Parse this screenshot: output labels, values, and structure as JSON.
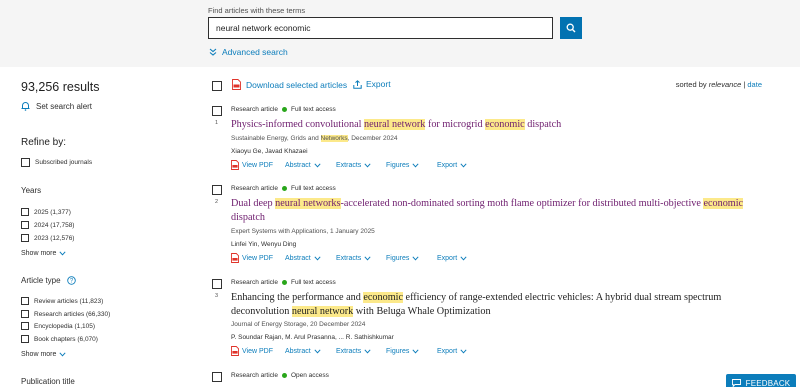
{
  "search": {
    "label": "Find articles with these terms",
    "value": "neural network economic",
    "button_icon": "search-icon",
    "advanced_label": "Advanced search"
  },
  "sidebar": {
    "results_count": "93,256 results",
    "set_alert": "Set search alert",
    "refine_title": "Refine by:",
    "subscribed": "Subscribed journals",
    "years_title": "Years",
    "years": [
      "2025 (1,377)",
      "2024 (17,758)",
      "2023 (12,576)"
    ],
    "show_more": "Show more",
    "article_type_title": "Article type",
    "article_types": [
      "Review articles (11,823)",
      "Research articles (66,330)",
      "Encyclopedia (1,105)",
      "Book chapters (6,070)"
    ],
    "publication_title": "Publication title"
  },
  "toolbar": {
    "download": "Download selected articles",
    "export": "Export",
    "sorted_by": "sorted by",
    "relevance": "relevance",
    "separator": "|",
    "date": "date"
  },
  "results": [
    {
      "number": "1",
      "type": "Research article",
      "access": "Full text access",
      "title": [
        "Physics-informed convolutional ",
        {
          "hl": "neural network"
        },
        " for microgrid ",
        {
          "hl": "economic"
        },
        " dispatch"
      ],
      "source": [
        "Sustainable Energy, Grids and ",
        {
          "hl": "Networks"
        },
        ", December 2024"
      ],
      "authors": "Xiaoyu Ge, Javad Khazaei"
    },
    {
      "number": "2",
      "type": "Research article",
      "access": "Full text access",
      "title": [
        "Dual deep ",
        {
          "hl": "neural networks"
        },
        "-accelerated non-dominated sorting moth flame optimizer for distributed multi-objective ",
        {
          "hl": "economic"
        },
        " dispatch"
      ],
      "source": [
        "Expert Systems with Applications, 1 January 2025"
      ],
      "authors": "Linfei Yin, Wenyu Ding"
    },
    {
      "number": "3",
      "type": "Research article",
      "access": "Full text access",
      "title": [
        "Enhancing the performance and ",
        {
          "hl": "economic"
        },
        " efficiency of range-extended electric vehicles: A hybrid dual stream spectrum deconvolution ",
        {
          "hl": "neural network"
        },
        " with Beluga Whale Optimization"
      ],
      "source": [
        "Journal of Energy Storage, 20 December 2024"
      ],
      "authors": "P. Soundar Rajan, M. Arul Prasanna, ... R. Sathishkumar"
    },
    {
      "type": "Research article",
      "access": "Open access"
    }
  ],
  "actions": {
    "view_pdf": "View PDF",
    "abstract": "Abstract",
    "extracts": "Extracts",
    "figures": "Figures",
    "export": "Export"
  },
  "feedback": "FEEDBACK",
  "colors": {
    "link": "#0c7dbb",
    "search_button": "#0272b1",
    "visited_title": "#6e1d6e",
    "highlight": "#fce98a",
    "access_dot": "#29a61b",
    "pdf_icon": "#e0342b"
  }
}
